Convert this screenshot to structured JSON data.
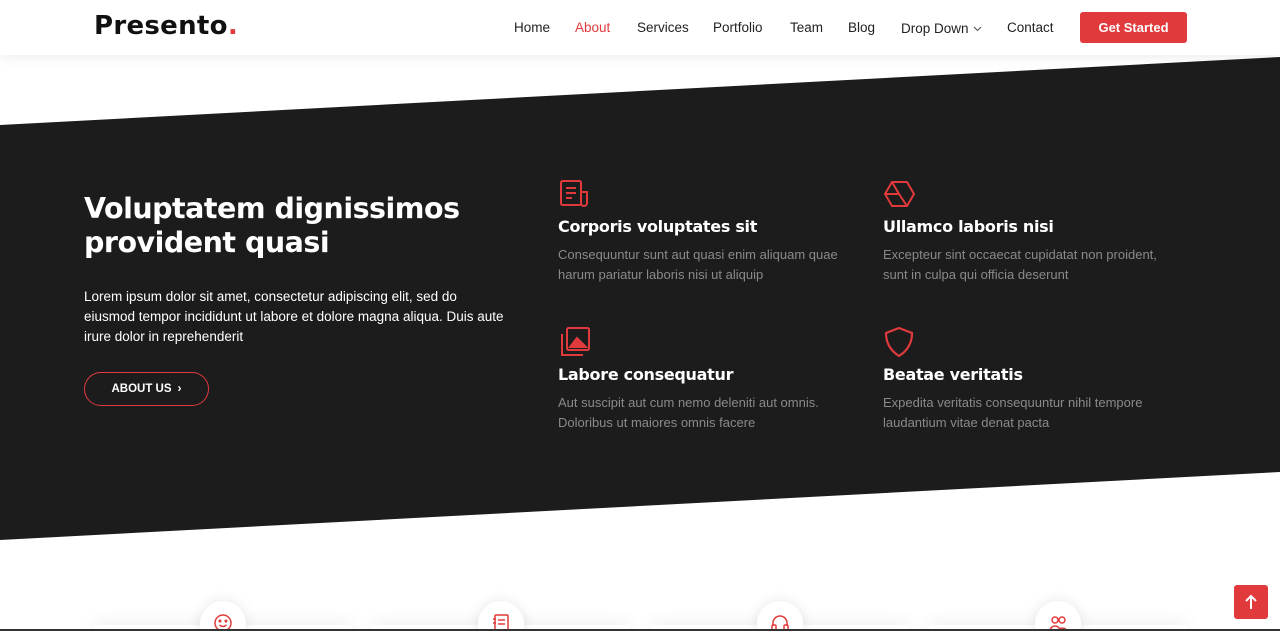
{
  "header": {
    "logo_text": "Presento",
    "logo_dot": ".",
    "nav": [
      {
        "label": "Home",
        "active": false
      },
      {
        "label": "About",
        "active": true
      },
      {
        "label": "Services",
        "active": false
      },
      {
        "label": "Portfolio",
        "active": false
      },
      {
        "label": "Team",
        "active": false
      },
      {
        "label": "Blog",
        "active": false
      },
      {
        "label": "Drop Down",
        "active": false
      },
      {
        "label": "Contact",
        "active": false
      }
    ],
    "cta_label": "Get Started"
  },
  "about": {
    "title": "Voluptatem dignissimos provident quasi",
    "text": "Lorem ipsum dolor sit amet, consectetur adipiscing elit, sed do eiusmod tempor incididunt ut labore et dolore magna aliqua. Duis aute irure dolor in reprehenderit",
    "button_label": "ABOUT US",
    "features": [
      {
        "icon": "receipt-icon",
        "title": "Corporis voluptates sit",
        "text": "Consequuntur sunt aut quasi enim aliquam quae harum pariatur laboris nisi ut aliquip"
      },
      {
        "icon": "cube-icon",
        "title": "Ullamco laboris nisi",
        "text": "Excepteur sint occaecat cupidatat non proident, sunt in culpa qui officia deserunt"
      },
      {
        "icon": "images-icon",
        "title": "Labore consequatur",
        "text": "Aut suscipit aut cum nemo deleniti aut omnis. Doloribus ut maiores omnis facere"
      },
      {
        "icon": "shield-icon",
        "title": "Beatae veritatis",
        "text": "Expedita veritatis consequuntur nihil tempore laudantium vitae denat pacta"
      }
    ]
  },
  "bottom_icons": [
    "emoji-smile-icon",
    "journal-richtext-icon",
    "headset-icon",
    "people-icon"
  ],
  "colors": {
    "accent": "#e03a3c",
    "dark": "#1c1c1d",
    "muted_text": "#8a8a8a"
  }
}
